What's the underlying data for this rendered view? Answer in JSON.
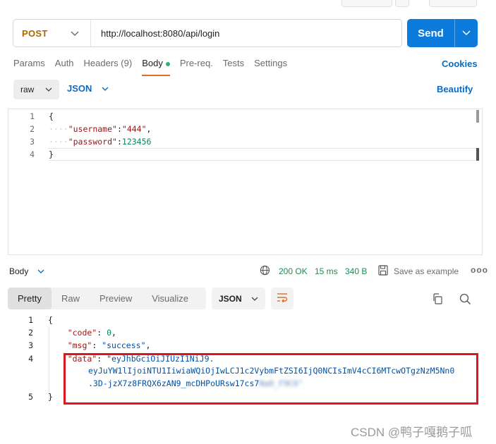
{
  "request": {
    "method": "POST",
    "url": "http://localhost:8080/api/login",
    "send_label": "Send"
  },
  "request_tabs": [
    {
      "label": "Params"
    },
    {
      "label": "Auth"
    },
    {
      "label": "Headers (9)"
    },
    {
      "label": "Body"
    },
    {
      "label": "Pre-req."
    },
    {
      "label": "Tests"
    },
    {
      "label": "Settings"
    }
  ],
  "active_request_tab": "Body",
  "cookies_label": "Cookies",
  "body_mode": "raw",
  "body_format": "JSON",
  "beautify_label": "Beautify",
  "request_body": {
    "line_numbers": [
      "1",
      "2",
      "3",
      "4"
    ],
    "open_brace": "{",
    "close_brace": "}",
    "username_key": "\"username\"",
    "username_value": "\"444\"",
    "password_key": "\"password\"",
    "password_value": "123456"
  },
  "response": {
    "section_label": "Body",
    "status": "200 OK",
    "time": "15 ms",
    "size": "340 B",
    "save_label": "Save as example",
    "more_label": "ooo",
    "view_tabs": [
      {
        "label": "Pretty"
      },
      {
        "label": "Raw"
      },
      {
        "label": "Preview"
      },
      {
        "label": "Visualize"
      }
    ],
    "active_view": "Pretty",
    "format": "JSON",
    "line_numbers": [
      "1",
      "2",
      "3",
      "4",
      "5"
    ],
    "open_brace": "{",
    "close_brace": "}",
    "code_key": "\"code\"",
    "code_value": "0",
    "msg_key": "\"msg\"",
    "msg_value": "\"success\"",
    "data_key": "\"data\"",
    "data_line1": "\"eyJhbGciOiJIUzI1NiJ9.",
    "data_line2": "eyJuYW1lIjoiNTU1IiwiaWQiOjIwLCJ1c2VybmFtZSI6IjQ0NCIsImV4cCI6MTcwOTgzNzM5Nn0",
    "data_line3_visible": ".3D-jzX7z8FRQX6zAN9_mcDHPoURsw17cs7",
    "data_line3_blurred": "Na0_F9C6\"",
    "data_line3_end": "\""
  },
  "watermark": "CSDN @鸭子嘎鹅子呱",
  "colors": {
    "send": "#0c7bdc",
    "method": "#a86a00",
    "status_ok": "#1e8e4f",
    "highlight_box": "#e0161c",
    "body_dot": "#2db36f",
    "link": "#0c6bc1"
  }
}
